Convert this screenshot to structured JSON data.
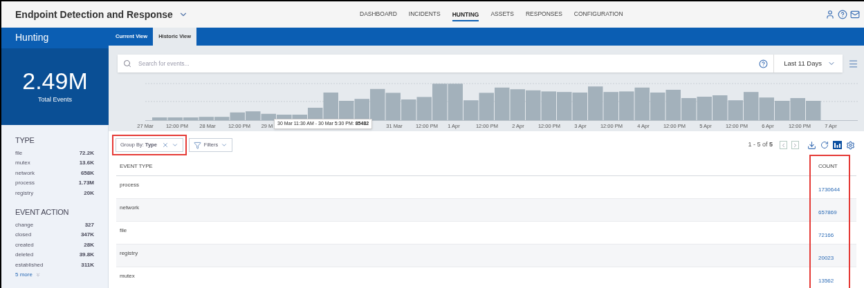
{
  "app_title": "Endpoint Detection and Response",
  "nav": [
    {
      "label": "DASHBOARD",
      "selected": false
    },
    {
      "label": "INCIDENTS",
      "selected": false
    },
    {
      "label": "HUNTING",
      "selected": true
    },
    {
      "label": "ASSETS",
      "selected": false
    },
    {
      "label": "RESPONSES",
      "selected": false
    },
    {
      "label": "CONFIGURATION",
      "selected": false
    }
  ],
  "page_title": "Hunting",
  "tabs": [
    {
      "label": "Current View",
      "selected": false
    },
    {
      "label": "Historic View",
      "selected": true
    }
  ],
  "total": {
    "value": "2.49M",
    "label": "Total Events"
  },
  "search": {
    "placeholder": "Search for events..."
  },
  "range": "Last 11 Days",
  "histogram": {
    "axis_labels": [
      "27 Mar",
      "12:00 PM",
      "28 Mar",
      "12:00 PM",
      "29 M",
      "31 Mar",
      "12:00 PM",
      "1 Apr",
      "12:00 PM",
      "2 Apr",
      "12:00 PM",
      "3 Apr",
      "12:00 PM",
      "4 Apr",
      "12:00 PM",
      "5 Apr",
      "12:00 PM",
      "6 Apr",
      "12:00 PM",
      "7 Apr"
    ],
    "tooltip": "30 Mar 11:30 AM - 30 Mar 5:30 PM: **85482**"
  },
  "facets": [
    {
      "title": "TYPE",
      "items": [
        {
          "name": "file",
          "count": "72.2K"
        },
        {
          "name": "mutex",
          "count": "13.6K"
        },
        {
          "name": "network",
          "count": "658K"
        },
        {
          "name": "process",
          "count": "1.73M"
        },
        {
          "name": "registry",
          "count": "20K"
        }
      ]
    },
    {
      "title": "EVENT ACTION",
      "items": [
        {
          "name": "change",
          "count": "327"
        },
        {
          "name": "closed",
          "count": "347K"
        },
        {
          "name": "created",
          "count": "28K"
        },
        {
          "name": "deleted",
          "count": "39.8K"
        },
        {
          "name": "established",
          "count": "311K"
        }
      ],
      "more": "5 more"
    }
  ],
  "group_by": {
    "label": "Group By:",
    "value": "Type"
  },
  "filters": "Filters",
  "pagination": {
    "range": "1 - 5 of",
    "total": "5"
  },
  "table": {
    "columns": [
      "EVENT TYPE",
      "COUNT"
    ],
    "rows": [
      [
        "process",
        "1730644"
      ],
      [
        "network",
        "657869"
      ],
      [
        "file",
        "72166"
      ],
      [
        "registry",
        "20023"
      ],
      [
        "mutex",
        "13562"
      ]
    ]
  }
}
